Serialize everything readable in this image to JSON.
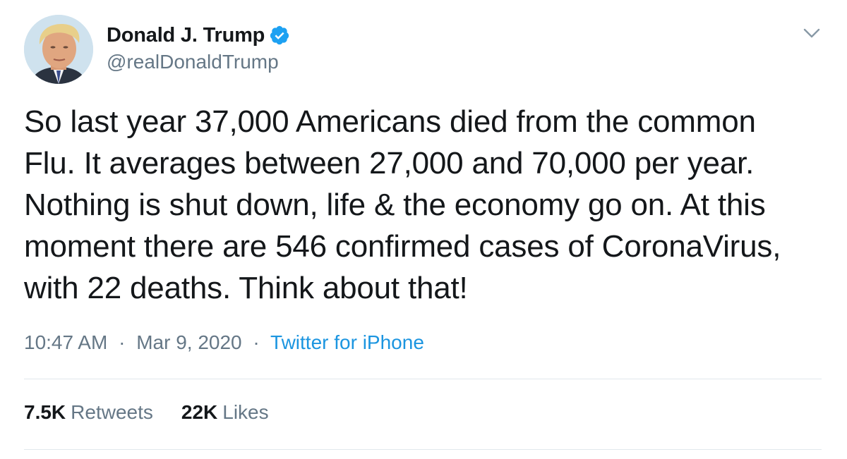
{
  "author": {
    "display_name": "Donald J. Trump",
    "handle": "@realDonaldTrump",
    "verified": true,
    "avatar_icon": "profile-photo"
  },
  "tweet": {
    "text": "So last year 37,000 Americans died from the common\nFlu. It averages between 27,000 and 70,000 per year.\nNothing is shut down, life & the economy go on. At this\nmoment there are 546 confirmed cases of CoronaVirus,\nwith 22 deaths. Think about that!",
    "time": "10:47 AM",
    "date": "Mar 9, 2020",
    "separator": "·",
    "source": "Twitter for iPhone"
  },
  "stats": {
    "retweets_count": "7.5K",
    "retweets_label": "Retweets",
    "likes_count": "22K",
    "likes_label": "Likes"
  },
  "icons": {
    "verified": "verified-badge-icon",
    "caret": "chevron-down-icon"
  },
  "colors": {
    "text_primary": "#14171a",
    "text_secondary": "#657786",
    "link": "#1b95e0",
    "verified": "#1da1f2",
    "divider": "#e1e8ed"
  }
}
